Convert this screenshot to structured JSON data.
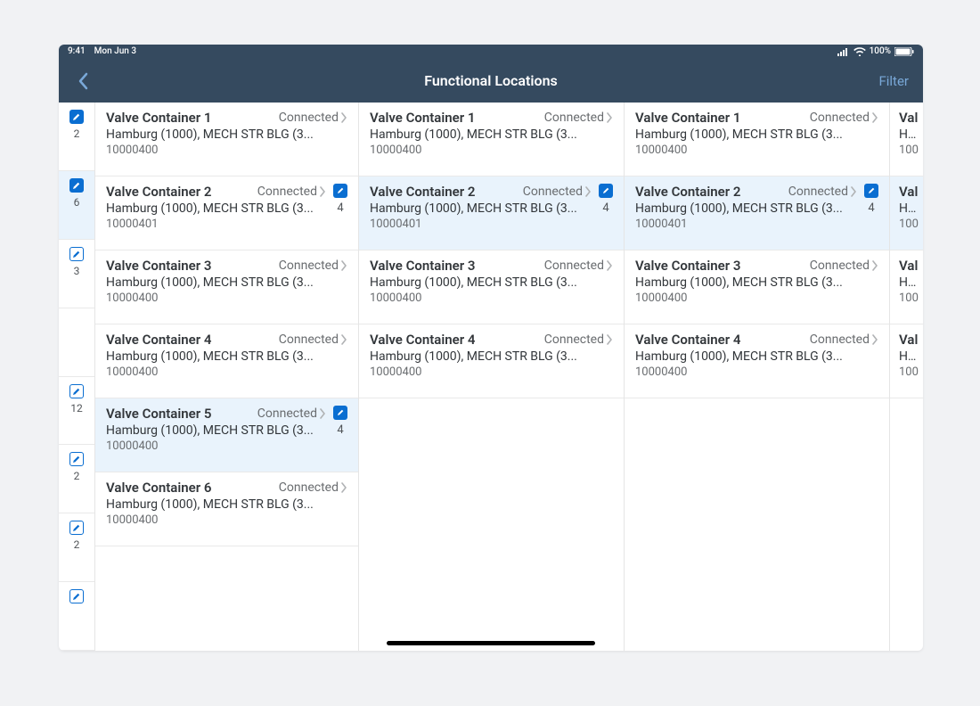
{
  "status": {
    "time": "9:41",
    "date": "Mon Jun 3",
    "battery": "100%"
  },
  "nav": {
    "title": "Functional Locations",
    "filter": "Filter"
  },
  "status_label": "Connected",
  "sidebar": {
    "items": [
      {
        "count": "2",
        "filled": true,
        "selected": false
      },
      {
        "count": "6",
        "filled": true,
        "selected": true
      },
      {
        "count": "3",
        "filled": false,
        "selected": false
      },
      {
        "count": "",
        "filled": false,
        "selected": false,
        "noicon": true
      },
      {
        "count": "12",
        "filled": false,
        "selected": false
      },
      {
        "count": "2",
        "filled": false,
        "selected": false
      },
      {
        "count": "2",
        "filled": false,
        "selected": false
      },
      {
        "count": "",
        "filled": false,
        "selected": false
      }
    ]
  },
  "panes": [
    {
      "rows": [
        {
          "title": "Valve Container 1",
          "sub": "Hamburg (1000), MECH STR BLG (3...",
          "id": "10000400",
          "status": "Connected",
          "selected": false
        },
        {
          "title": "Valve Container 2",
          "sub": "Hamburg (1000), MECH STR BLG (3...",
          "id": "10000401",
          "status": "Connected",
          "selected": false,
          "badge": {
            "filled": true,
            "count": "4"
          }
        },
        {
          "title": "Valve Container 3",
          "sub": "Hamburg (1000), MECH STR BLG (3...",
          "id": "10000400",
          "status": "Connected",
          "selected": false
        },
        {
          "title": "Valve Container 4",
          "sub": "Hamburg (1000), MECH STR BLG (3...",
          "id": "10000400",
          "status": "Connected",
          "selected": false
        },
        {
          "title": "Valve Container 5",
          "sub": "Hamburg (1000), MECH STR BLG (3...",
          "id": "10000400",
          "status": "Connected",
          "selected": true,
          "badge": {
            "filled": true,
            "count": "4"
          }
        },
        {
          "title": "Valve Container 6",
          "sub": "Hamburg (1000), MECH STR BLG (3...",
          "id": "10000400",
          "status": "Connected",
          "selected": false
        }
      ]
    },
    {
      "rows": [
        {
          "title": "Valve Container 1",
          "sub": "Hamburg (1000), MECH STR BLG (3...",
          "id": "10000400",
          "status": "Connected",
          "selected": false
        },
        {
          "title": "Valve Container 2",
          "sub": "Hamburg (1000), MECH STR BLG (3...",
          "id": "10000401",
          "status": "Connected",
          "selected": true,
          "badge": {
            "filled": true,
            "count": "4"
          }
        },
        {
          "title": "Valve Container 3",
          "sub": "Hamburg (1000), MECH STR BLG (3...",
          "id": "10000400",
          "status": "Connected",
          "selected": false
        },
        {
          "title": "Valve Container 4",
          "sub": "Hamburg (1000), MECH STR BLG (3...",
          "id": "10000400",
          "status": "Connected",
          "selected": false
        }
      ]
    },
    {
      "rows": [
        {
          "title": "Valve Container 1",
          "sub": "Hamburg (1000), MECH STR BLG (3...",
          "id": "10000400",
          "status": "Connected",
          "selected": false
        },
        {
          "title": "Valve Container 2",
          "sub": "Hamburg (1000), MECH STR BLG (3...",
          "id": "10000401",
          "status": "Connected",
          "selected": true,
          "badge": {
            "filled": true,
            "count": "4"
          }
        },
        {
          "title": "Valve Container 3",
          "sub": "Hamburg (1000), MECH STR BLG (3...",
          "id": "10000400",
          "status": "Connected",
          "selected": false
        },
        {
          "title": "Valve Container 4",
          "sub": "Hamburg (1000), MECH STR BLG (3...",
          "id": "10000400",
          "status": "Connected",
          "selected": false
        }
      ]
    },
    {
      "rows": [
        {
          "title": "Val",
          "sub": "Ham",
          "id": "100",
          "selected": false
        },
        {
          "title": "Val",
          "sub": "Ham",
          "id": "100",
          "selected": true
        },
        {
          "title": "Val",
          "sub": "Ham",
          "id": "100",
          "selected": false
        },
        {
          "title": "Val",
          "sub": "Ham",
          "id": "100",
          "selected": false
        }
      ]
    }
  ]
}
